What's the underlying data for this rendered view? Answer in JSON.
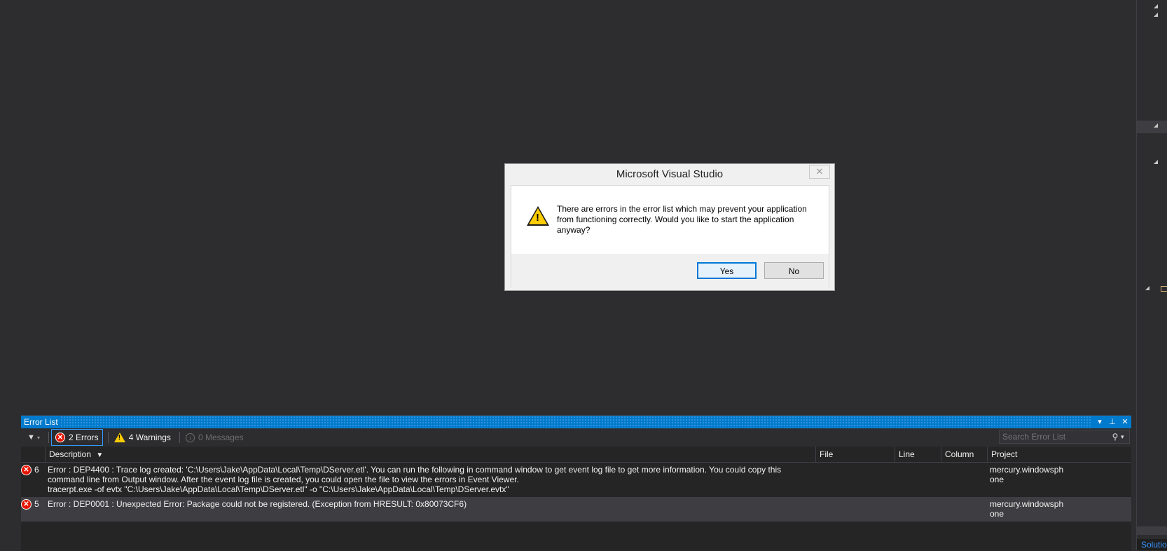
{
  "dialog": {
    "title": "Microsoft Visual Studio",
    "close_glyph": "✕",
    "message": "There are errors in the error list which may prevent your application from functioning correctly.  Would you like to start the application anyway?",
    "icon": "warning-icon",
    "yes_label": "Yes",
    "no_label": "No"
  },
  "error_list": {
    "title": "Error List",
    "errors_label": "2 Errors",
    "warnings_label": "4 Warnings",
    "messages_label": "0 Messages",
    "search_placeholder": "Search Error List",
    "columns": {
      "description": "Description",
      "file": "File",
      "line": "Line",
      "column": "Column",
      "project": "Project"
    },
    "rows": [
      {
        "num": "6",
        "description": "Error : DEP4400 : Trace log created: 'C:\\Users\\Jake\\AppData\\Local\\Temp\\DServer.etl'. You can run the following in command window to get event log file to get more information. You could copy this command line from Output window. After the event log file is created, you could open the file to view the errors in Event Viewer.\ntracerpt.exe -of evtx \"C:\\Users\\Jake\\AppData\\Local\\Temp\\DServer.etl\" -o \"C:\\Users\\Jake\\AppData\\Local\\Temp\\DServer.evtx\"",
        "file": "",
        "line": "",
        "column": "",
        "project": "mercury.windowsphone"
      },
      {
        "num": "5",
        "description": "Error : DEP0001 : Unexpected Error: Package could not be registered. (Exception from HRESULT: 0x80073CF6)",
        "file": "",
        "line": "",
        "column": "",
        "project": "mercury.windowsphone"
      }
    ]
  },
  "right_panel": {
    "solution_tab": "Solutio"
  },
  "colors": {
    "editor_bg": "#2d2d30",
    "accent": "#007acc",
    "error": "#e51400",
    "warning": "#ffcc00"
  }
}
